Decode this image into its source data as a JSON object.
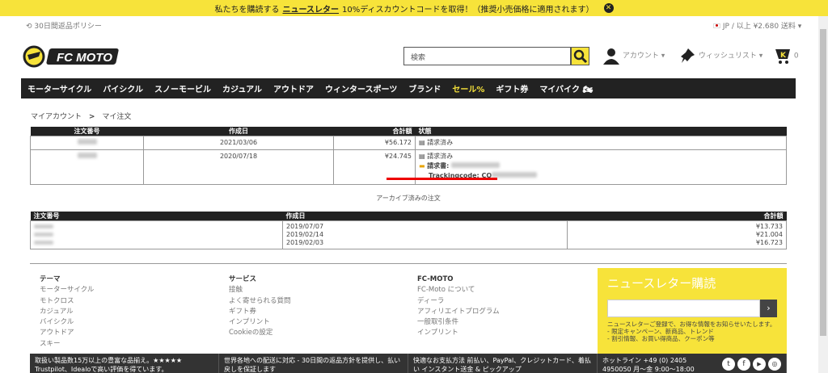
{
  "topbar": {
    "pre": "私たちを購読する",
    "link": "ニュースレター",
    "post": "10%ディスカウントコードを取得！（推奨小売価格に適用されます）"
  },
  "util": {
    "returns": "30日間返品ポリシー",
    "region": "JP / 以上 ¥2.680 送料 ▾"
  },
  "logo": {
    "text": "FC MOTO"
  },
  "search": {
    "placeholder": "検索"
  },
  "header": {
    "account": "アカウント ▾",
    "wishlist": "ウィッシュリスト ▾",
    "cart_count": "0"
  },
  "nav": [
    "モーターサイクル",
    "バイシクル",
    "スノーモービル",
    "カジュアル",
    "アウトドア",
    "ウィンタースポーツ",
    "ブランド",
    "セール%",
    "ギフト券",
    "マイバイク"
  ],
  "breadcrumb": {
    "a": "マイアカウント",
    "sep": ">",
    "b": "マイ注文"
  },
  "orders": {
    "headers": [
      "注文番号",
      "作成日",
      "合計額",
      "状態"
    ],
    "rows": [
      {
        "date": "2021/03/06",
        "total": "¥56.172",
        "status": "請求済み"
      },
      {
        "date": "2020/07/18",
        "total": "¥24.745",
        "status": "請求済み",
        "invoice": "請求書:",
        "tracking": "Trackingcode: CQ"
      }
    ]
  },
  "archive": {
    "title": "アーカイブ済みの注文",
    "headers": [
      "注文番号",
      "作成日",
      "合計額"
    ],
    "rows": [
      {
        "date": "2019/07/07",
        "total": "¥13.733"
      },
      {
        "date": "2019/02/14",
        "total": "¥21.004"
      },
      {
        "date": "2019/02/03",
        "total": "¥16.723"
      }
    ]
  },
  "footer": {
    "col1": {
      "title": "テーマ",
      "items": [
        "モーターサイクル",
        "モトクロス",
        "カジュアル",
        "バイシクル",
        "アウトドア",
        "スキー"
      ]
    },
    "col2": {
      "title": "サービス",
      "items": [
        "接触",
        "よく寄せられる質問",
        "ギフト券",
        "インプリント",
        "Cookieの設定"
      ]
    },
    "col3": {
      "title": "FC-MOTO",
      "items": [
        "FC-Moto について",
        "ディーラ",
        "アフィリエイトプログラム",
        "一般取引条件",
        "インプリント"
      ]
    },
    "news": {
      "title": "ニュースレター購読",
      "desc": "ニュースレターご登録で、お得な情報をお知らせいたします。",
      "b1": "- 限定キャンペーン、新商品、トレンド",
      "b2": "- 割引情報、お買い得商品、クーポン等"
    }
  },
  "strip": [
    "取扱い製品数15万以上の豊富な品揃え。★★★★★ Trustpilot、Idealoで高い評価を得ています。",
    "世界各地への配送に対応 - 30日間の返品方針を提供し、払い戻しを保証します",
    "快適なお支払方法 前払い、PayPal、クレジットカード、着払い インスタント送金 & ピックアップ",
    "ホットライン +49 (0) 2405 4950050 月〜金 9:00〜18:00"
  ]
}
